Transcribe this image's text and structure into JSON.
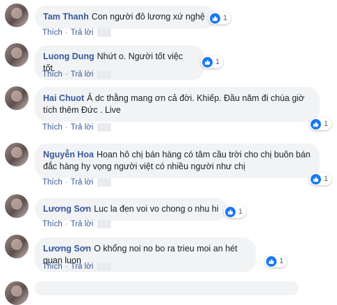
{
  "comments": [
    {
      "author": "Tam Thanh",
      "text": "Con người đô lương xứ nghệ",
      "reactions": "1",
      "like": "Thích",
      "reply": "Trả lời"
    },
    {
      "author": "Luong Dung",
      "text": "Nhứt o. Người tốt việc tốt.",
      "reactions": "1",
      "like": "Thích",
      "reply": "Trả lời"
    },
    {
      "author": "Hai Chuot",
      "text": "Ả dc thằng mang ơn cả đời. Khiếp. Đầu năm đi chùa giờ tích thêm Đức . Live",
      "reactions": "1",
      "like": "Thích",
      "reply": "Trả lời"
    },
    {
      "author": "Nguyễn Hoa",
      "text": "Hoan hô chị bán hàng có tâm cầu trời cho chị buôn bán đắc hàng hy vọng người việt có nhiều người như chị",
      "reactions": "1",
      "like": "Thích",
      "reply": "Trả lời"
    },
    {
      "author": "Lương Sơn",
      "text": "Luc la đen voi vo chong o nhu hi",
      "reactions": "1",
      "like": "Thích",
      "reply": "Trả lời"
    },
    {
      "author": "Lương Sơn",
      "text": "O khổng noi no bo ra trieu moi an hét quan luon",
      "reactions": "1",
      "like": "Thích",
      "reply": "Trả lời"
    }
  ],
  "colors": {
    "author": "#385898",
    "bubble": "#f2f3f5",
    "like_icon": "#1877f2"
  },
  "icons": {
    "reaction": "thumbs-up-icon"
  }
}
